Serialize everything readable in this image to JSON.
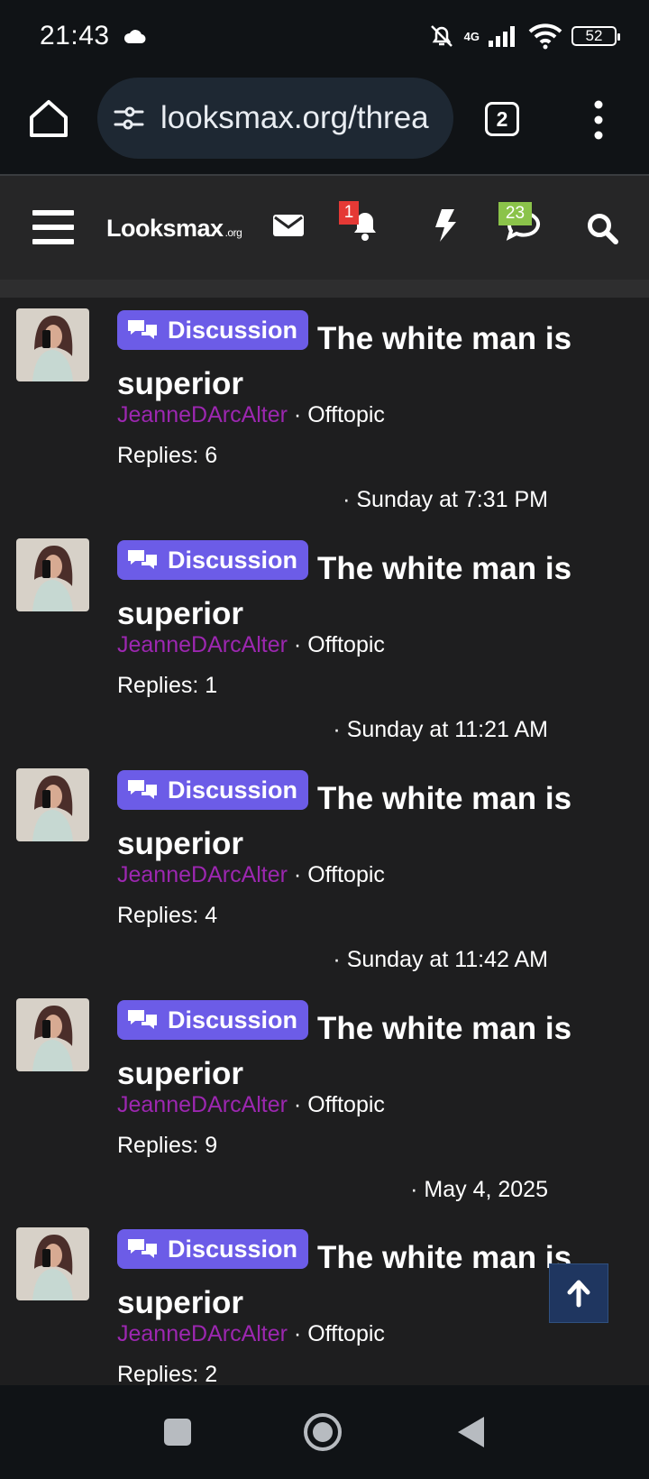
{
  "status": {
    "time": "21:43",
    "network_label": "4G",
    "battery": "52"
  },
  "browser": {
    "url": "looksmax.org/threa",
    "tab_count": "2"
  },
  "site": {
    "logo_main": "Looksmax",
    "logo_suffix": ".org",
    "alert_badge": "1",
    "conversation_badge": "23"
  },
  "threads": [
    {
      "prefix": "Discussion",
      "title": "The white man is superior",
      "author": "JeanneDArcAlter",
      "forum": "Offtopic",
      "replies": "Replies: 6",
      "date": "Sunday at 7:31 PM"
    },
    {
      "prefix": "Discussion",
      "title": "The white man is superior",
      "author": "JeanneDArcAlter",
      "forum": "Offtopic",
      "replies": "Replies: 1",
      "date": "Sunday at 11:21 AM"
    },
    {
      "prefix": "Discussion",
      "title": "The white man is superior",
      "author": "JeanneDArcAlter",
      "forum": "Offtopic",
      "replies": "Replies: 4",
      "date": "Sunday at 11:42 AM"
    },
    {
      "prefix": "Discussion",
      "title": "The white man is superior",
      "author": "JeanneDArcAlter",
      "forum": "Offtopic",
      "replies": "Replies: 9",
      "date": "May 4, 2025"
    },
    {
      "prefix": "Discussion",
      "title": "The white man is superior",
      "author": "JeanneDArcAlter",
      "forum": "Offtopic",
      "replies": "Replies: 2",
      "date": ""
    }
  ],
  "colors": {
    "prefix": "#6c5ce7",
    "author": "#9c27b0",
    "alert_badge": "#e53935",
    "conversation_badge": "#8bc34a"
  }
}
